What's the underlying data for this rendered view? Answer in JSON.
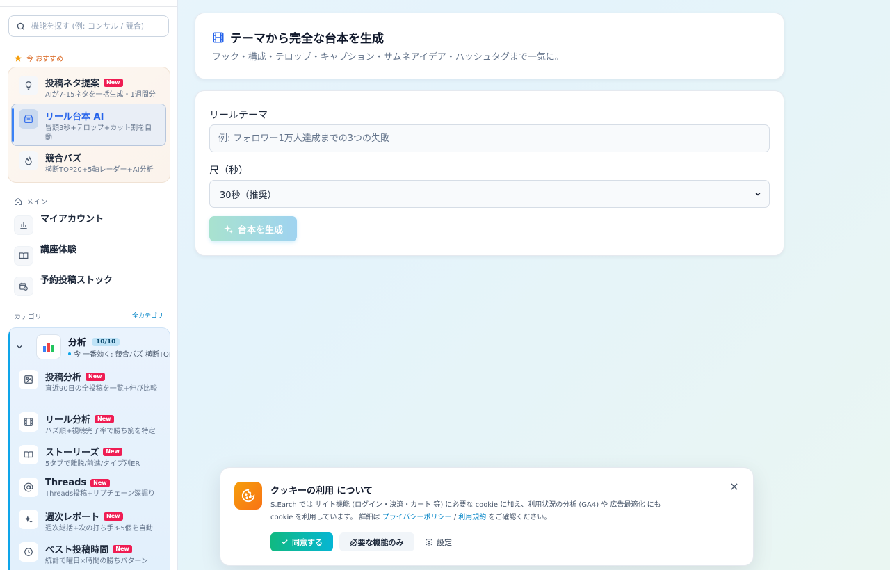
{
  "sidebar": {
    "search_placeholder": "機能を探す (例: コンサル / 競合)",
    "recommended_label": "今 おすすめ",
    "recommended": [
      {
        "title": "投稿ネタ提案",
        "badge": "New",
        "desc": "AIが7-15ネタを一括生成・1週間分"
      },
      {
        "title": "リール台本 AI",
        "badge": "",
        "desc": "冒頭3秒+テロップ+カット割を自動"
      },
      {
        "title": "競合バズ",
        "badge": "",
        "desc": "横断TOP20+5軸レーダー+AI分析"
      }
    ],
    "main_label": "メイン",
    "main_items": [
      {
        "label": "マイアカウント"
      },
      {
        "label": "講座体験"
      },
      {
        "label": "予約投稿ストック"
      }
    ],
    "category_label": "カテゴリ",
    "all_categories": "全カテゴリ",
    "category": {
      "name": "分析",
      "count": "10/10",
      "hint": "今 一番効く: 競合バズ 横断TOP",
      "items": [
        {
          "title": "投稿分析",
          "badge": "New",
          "desc": "直近90日の全投稿を一覧+伸び比較"
        },
        {
          "title": "リール分析",
          "badge": "New",
          "desc": "バズ順+視聴完了率で勝ち筋を特定"
        },
        {
          "title": "ストーリーズ",
          "badge": "New",
          "desc": "5タブで離脱/前進/タイプ別ER"
        },
        {
          "title": "Threads",
          "badge": "New",
          "desc": "Threads投稿+リプチェーン深掘り"
        },
        {
          "title": "週次レポート",
          "badge": "New",
          "desc": "週次総括+次の打ち手3-5個を自動"
        },
        {
          "title": "ベスト投稿時間",
          "badge": "New",
          "desc": "統計で曜日×時間の勝ちパターン"
        }
      ]
    }
  },
  "header": {
    "title": "テーマから完全な台本を生成",
    "subtitle": "フック・構成・テロップ・キャプション・サムネアイデア・ハッシュタグまで一気に。"
  },
  "form": {
    "theme_label": "リールテーマ",
    "theme_placeholder": "例: フォロワー1万人達成までの3つの失敗",
    "length_label": "尺（秒）",
    "length_value": "30秒（推奨）",
    "generate_label": "台本を生成"
  },
  "cookie": {
    "title": "クッキーの利用 について",
    "body_1": "S.Earch では サイト機能 (ログイン・決済・カート 等) に必要な cookie に加え、利用状況の分析 (GA4) や 広告最適化 にも",
    "body_2": "cookie を利用しています。 詳細は ",
    "privacy_link": "プライバシーポリシー",
    "sep": " / ",
    "terms_link": "利用規約",
    "body_3": " をご確認ください。",
    "agree_label": "同意する",
    "required_label": "必要な機能のみ",
    "settings_label": "設定"
  },
  "colors": {
    "accent_blue": "#3b82f6",
    "badge_red": "#ef1d53",
    "cookie_orange": "#f97316",
    "agree_green": "#10b981"
  }
}
